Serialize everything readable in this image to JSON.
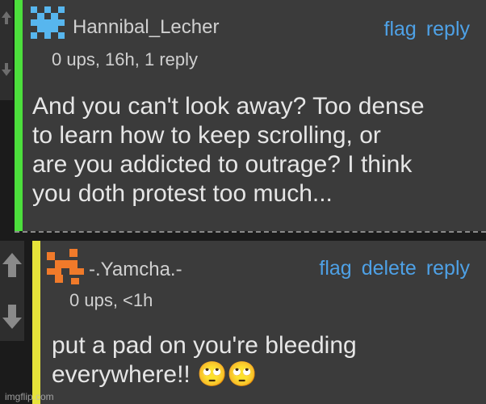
{
  "comments": [
    {
      "username": "Hannibal_Lecher",
      "meta": "0 ups, 16h, 1 reply",
      "actions": [
        "flag",
        "reply"
      ],
      "body": [
        "And you can't look away? Too dense",
        "to learn how to keep scrolling, or",
        "are you addicted to outrage? I think",
        "you doth protest too much..."
      ],
      "accent_color": "#4cdf3c",
      "avatar_color": "#57b6ee"
    },
    {
      "username": "-.Yamcha.-",
      "meta": "0 ups, <1h",
      "actions": [
        "flag",
        "delete",
        "reply"
      ],
      "body": [
        "put a pad on you're bleeding",
        "everywhere!! 🙄🙄"
      ],
      "accent_color": "#e6e33a",
      "avatar_color": "#f07a2a"
    }
  ],
  "icons": {
    "upvote": "up-arrow-icon",
    "downvote": "down-arrow-icon"
  },
  "watermark": "imgflip.com"
}
